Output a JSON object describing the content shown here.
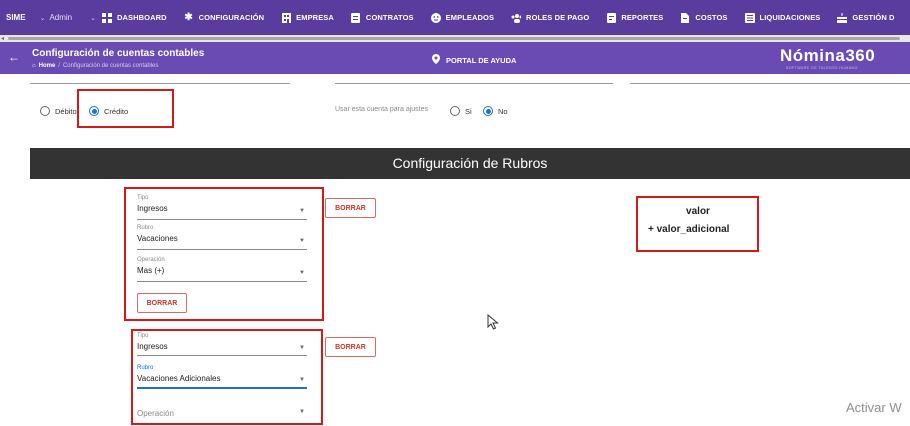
{
  "topnav": {
    "brand": "SIME",
    "admin": "Admin",
    "items": [
      {
        "label": "DASHBOARD",
        "icon": "grid-icon"
      },
      {
        "label": "CONFIGURACIÓN",
        "icon": "gear-icon"
      },
      {
        "label": "EMPRESA",
        "icon": "building-icon"
      },
      {
        "label": "CONTRATOS",
        "icon": "contract-icon"
      },
      {
        "label": "EMPLEADOS",
        "icon": "face-icon"
      },
      {
        "label": "ROLES DE PAGO",
        "icon": "people-icon"
      },
      {
        "label": "REPORTES",
        "icon": "report-icon"
      },
      {
        "label": "COSTOS",
        "icon": "file-icon"
      },
      {
        "label": "LIQUIDACIONES",
        "icon": "list-icon"
      },
      {
        "label": "GESTIÓN D",
        "icon": "cake-icon"
      }
    ]
  },
  "subheader": {
    "title": "Configuración de cuentas contables",
    "crumb_home": "Home",
    "crumb_current": "Configuración de cuentas contables",
    "help": "PORTAL DE AYUDA",
    "logo": "Nómina360",
    "logo_sub": "SOFTWARE DE TALENTO HUMANO"
  },
  "form": {
    "debit_label": "Débito",
    "credit_label": "Crédito",
    "adjust_label": "Usar esta cuenta para ajustes",
    "yes_label": "Si",
    "no_label": "No"
  },
  "section_title": "Configuración de Rubros",
  "rubros": [
    {
      "tipo_label": "Tipo",
      "tipo_value": "Ingresos",
      "rubro_label": "Rubro",
      "rubro_value": "Vacaciones",
      "operacion_label": "Operación",
      "operacion_value": "Mas (+)",
      "inner_button": "BORRAR",
      "side_button": "BORRAR"
    },
    {
      "tipo_label": "Tipo",
      "tipo_value": "Ingresos",
      "rubro_label": "Rubro",
      "rubro_value": "Vacaciones Adicionales",
      "operacion_label": "Operación",
      "side_button": "BORRAR"
    }
  ],
  "formula": {
    "line1": "valor",
    "line2": "+ valor_adicional"
  },
  "watermark": "Activar W",
  "colors": {
    "nav_bg": "#5a3c9e",
    "subheader_bg": "#6a4bb4",
    "highlight_red": "#d11a1a",
    "radio_blue": "#1a6fd8",
    "section_bar": "#333333"
  }
}
